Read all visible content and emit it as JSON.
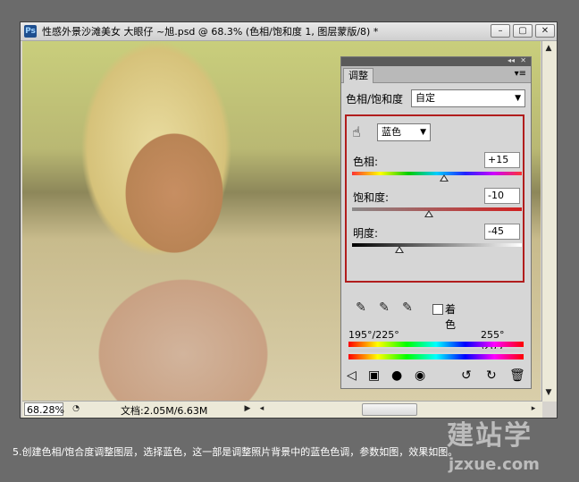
{
  "window": {
    "app_icon": "Ps",
    "title": "性感外景沙滩美女 大眼仔 ~旭.psd @ 68.3% (色相/饱和度 1, 图层蒙版/8) *",
    "buttons": {
      "minimize": "–",
      "restore": "▢",
      "close": "✕"
    }
  },
  "status": {
    "zoom": "68.28%",
    "doc_info": "文档:2.05M/6.63M",
    "arrow": "▶"
  },
  "panel": {
    "tab": "调整",
    "collapse_glyph": "◂◂",
    "close_glyph": "✕",
    "menu_glyph": "▾≡",
    "adjustment_name": "色相/饱和度",
    "preset": "自定",
    "channel": "蓝色",
    "hue_label": "色相:",
    "hue_value": "+15",
    "hue_fraction": 0.54,
    "saturation_label": "饱和度:",
    "saturation_value": "-10",
    "saturation_fraction": 0.45,
    "lightness_label": "明度:",
    "lightness_value": "-45",
    "lightness_fraction": 0.28,
    "colorize_label": "着色",
    "range_left": "195°/225°",
    "range_right": "255°\\285°",
    "icons": [
      "eyedropper-icon",
      "eyedropper-plus-icon",
      "eyedropper-minus-icon",
      "back-arrow-icon",
      "layer-clip-icon",
      "visibility-icon",
      "eye-icon",
      "refresh-icon",
      "reset-icon",
      "trash-icon"
    ]
  },
  "caption": "5.创建色相/饱合度调整图层，选择蓝色，这一部是调整照片背景中的蓝色色调，参数如图，效果如图。",
  "watermark": {
    "main": "建站学",
    "url": "jzxue.com"
  }
}
